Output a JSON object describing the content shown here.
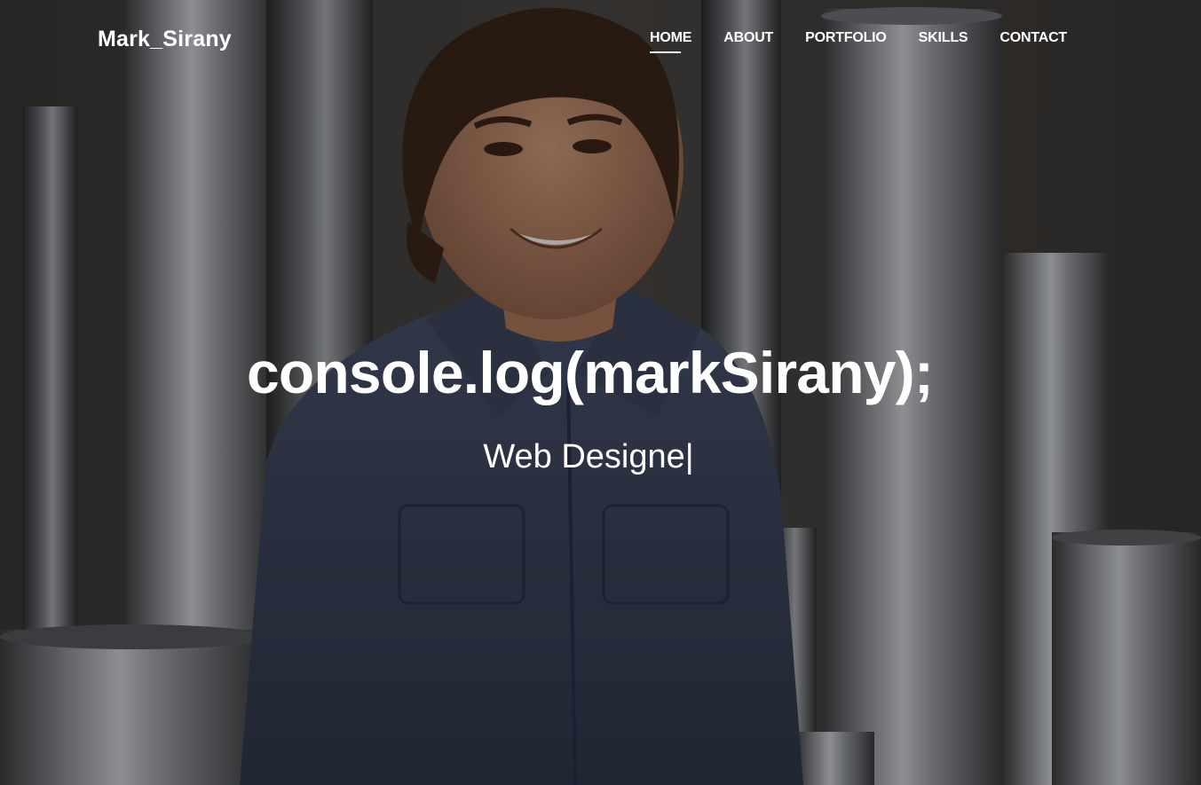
{
  "brand": "Mark_Sirany",
  "nav": {
    "items": [
      {
        "label": "HOME",
        "active": true
      },
      {
        "label": "ABOUT",
        "active": false
      },
      {
        "label": "PORTFOLIO",
        "active": false
      },
      {
        "label": "SKILLS",
        "active": false
      },
      {
        "label": "CONTACT",
        "active": false
      }
    ]
  },
  "hero": {
    "headline": "console.log(markSirany);",
    "typed_text": "Web Designe",
    "cursor": "|"
  }
}
